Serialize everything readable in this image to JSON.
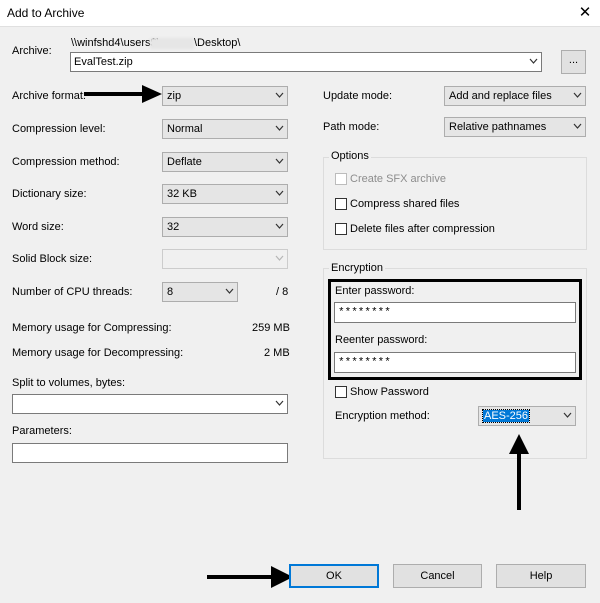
{
  "window": {
    "title": "Add to Archive",
    "close_icon": "close-icon"
  },
  "archive": {
    "label": "Archive:",
    "path": "\\\\winfshd4\\users$\\",
    "path_redacted": "\\Desktop\\",
    "filename": "EvalTest.zip",
    "browse_label": "..."
  },
  "left": {
    "format_label": "Archive format:",
    "format_value": "zip",
    "level_label": "Compression level:",
    "level_value": "Normal",
    "method_label": "Compression method:",
    "method_value": "Deflate",
    "dict_label": "Dictionary size:",
    "dict_value": "32 KB",
    "word_label": "Word size:",
    "word_value": "32",
    "solid_label": "Solid Block size:",
    "solid_value": "",
    "threads_label": "Number of CPU threads:",
    "threads_value": "8",
    "threads_max": "/ 8",
    "mem_comp_label": "Memory usage for Compressing:",
    "mem_comp_value": "259 MB",
    "mem_decomp_label": "Memory usage for Decompressing:",
    "mem_decomp_value": "2 MB",
    "split_label": "Split to volumes, bytes:",
    "split_value": "",
    "params_label": "Parameters:",
    "params_value": ""
  },
  "right": {
    "update_label": "Update mode:",
    "update_value": "Add and replace files",
    "pathmode_label": "Path mode:",
    "pathmode_value": "Relative pathnames",
    "options_title": "Options",
    "opt_sfx": "Create SFX archive",
    "opt_shared": "Compress shared files",
    "opt_delete": "Delete files after compression",
    "enc_title": "Encryption",
    "enter_pw_label": "Enter password:",
    "enter_pw_value": "********",
    "reenter_pw_label": "Reenter password:",
    "reenter_pw_value": "********",
    "show_pw_label": "Show Password",
    "enc_method_label": "Encryption method:",
    "enc_method_value": "AES-256"
  },
  "buttons": {
    "ok": "OK",
    "cancel": "Cancel",
    "help": "Help"
  }
}
